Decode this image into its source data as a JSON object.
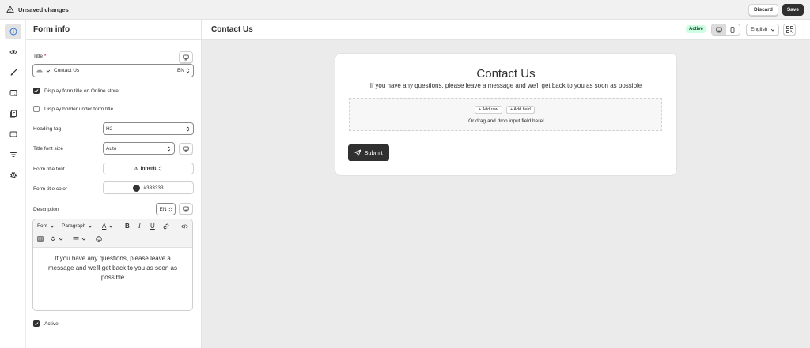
{
  "topbar": {
    "title": "Unsaved changes",
    "discard_label": "Discard",
    "save_label": "Save"
  },
  "rail": {
    "items": [
      "info-icon",
      "eye-icon",
      "brush-icon",
      "layout-icon",
      "page-icon",
      "mail-icon",
      "filter-icon",
      "settings-icon"
    ],
    "active_index": 0
  },
  "sidebar": {
    "title": "Form info",
    "title_field": {
      "label": "Title",
      "required_mark": "*",
      "value": "Contact Us",
      "lang": "EN"
    },
    "display_title": {
      "label": "Display form title on Online store",
      "checked": true
    },
    "display_border": {
      "label": "Display border under form title",
      "checked": false
    },
    "heading_tag": {
      "label": "Heading tag",
      "value": "H2"
    },
    "title_font_size": {
      "label": "Title font size",
      "value": "Auto"
    },
    "form_title_font": {
      "label": "Form title font",
      "value": "Inherit"
    },
    "form_title_color": {
      "label": "Form title color",
      "value": "#333333",
      "swatch": "#333333"
    },
    "description": {
      "label": "Description",
      "lang": "EN",
      "toolbar": {
        "font": "Font",
        "paragraph": "Paragraph"
      },
      "text": "If you have any questions, please leave a message and we'll get back to you as soon as possible"
    },
    "active": {
      "label": "Active",
      "checked": true
    }
  },
  "main": {
    "title": "Contact Us",
    "status": "Active",
    "language": "English",
    "preview": {
      "title": "Contact Us",
      "description": "If you have any questions, please leave a message and we'll get back to you as soon as possible",
      "add_row": "+ Add row",
      "add_field": "+ Add field",
      "drop_hint": "Or drag and drop input field here!",
      "submit": "Submit"
    }
  },
  "colors": {
    "accent": "#303030",
    "active_badge_bg": "#cdfee1",
    "required": "#c70a24"
  }
}
